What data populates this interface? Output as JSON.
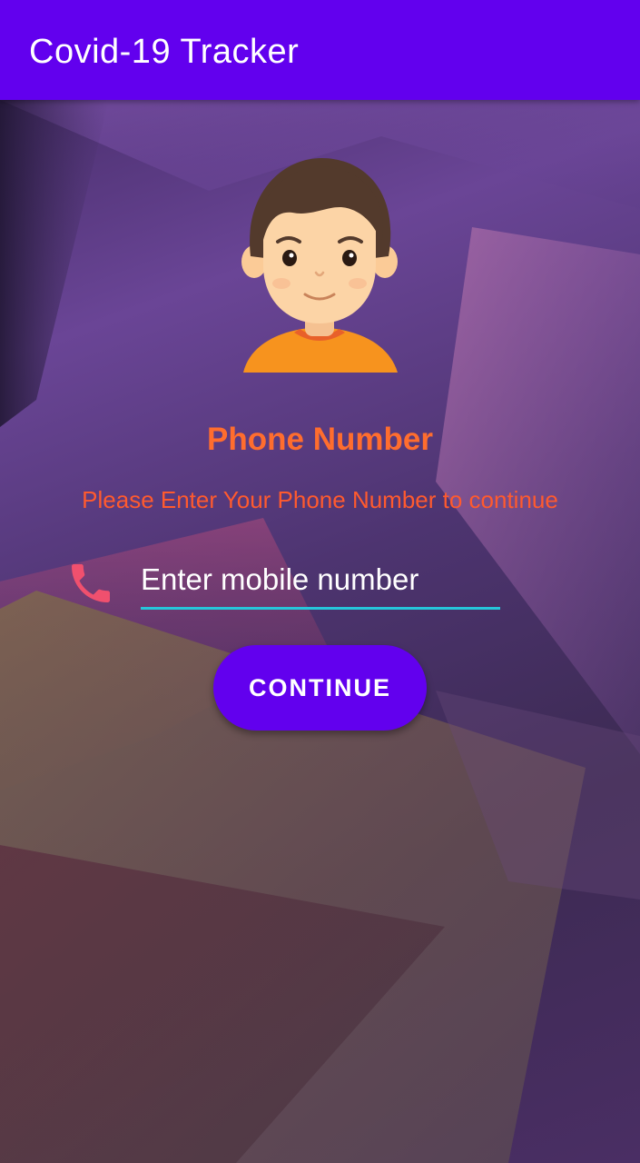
{
  "app_bar": {
    "title": "Covid-19 Tracker"
  },
  "theme": {
    "primary": "#6200ee",
    "accent_text": "#ff6d2e",
    "underline": "#26c6da",
    "phone_icon_color": "#f0506e"
  },
  "avatar": {
    "icon": "user-avatar-icon"
  },
  "form": {
    "heading": "Phone Number",
    "subheading": "Please Enter Your Phone Number to continue",
    "phone_icon": "phone-icon",
    "mobile_input": {
      "value": "",
      "placeholder": "Enter mobile number"
    },
    "continue_label": "CONTINUE"
  }
}
